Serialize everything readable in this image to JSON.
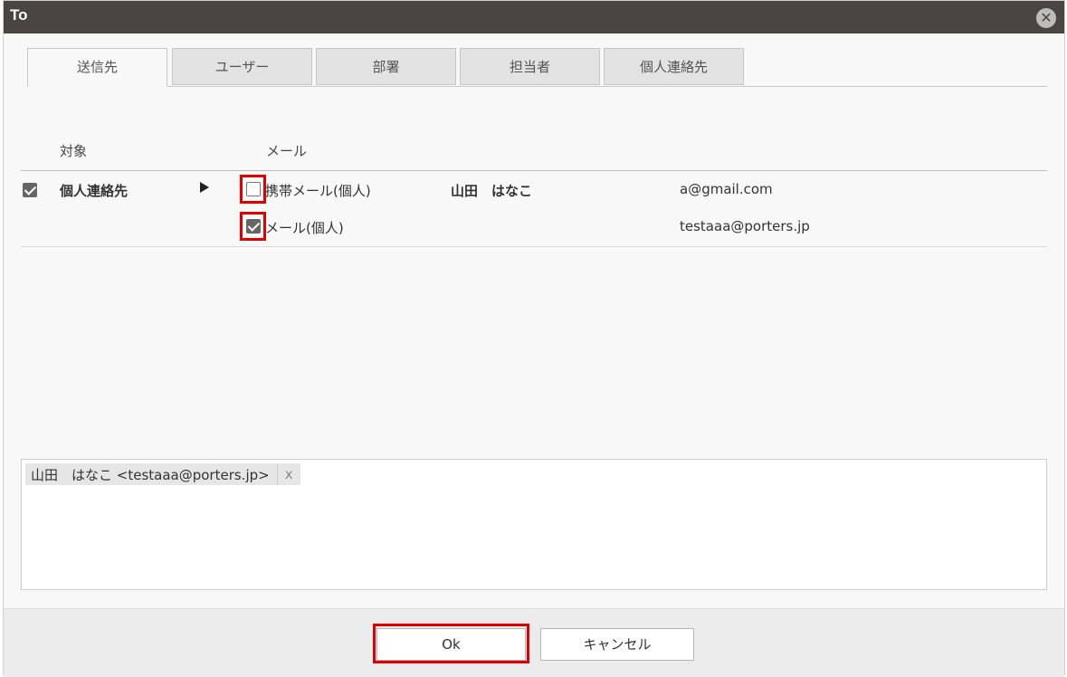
{
  "dialog": {
    "title": "To",
    "close_glyph": "✕"
  },
  "tabs": [
    {
      "label": "送信先",
      "active": true
    },
    {
      "label": "ユーザー",
      "active": false
    },
    {
      "label": "部署",
      "active": false
    },
    {
      "label": "担当者",
      "active": false
    },
    {
      "label": "個人連絡先",
      "active": false
    }
  ],
  "table": {
    "headers": {
      "target": "対象",
      "mail": "メール"
    },
    "row": {
      "checked": true,
      "target": "個人連絡先",
      "name": "山田　はなこ",
      "mails": [
        {
          "type": "携帯メール(個人)",
          "address": "a@gmail.com",
          "checked": false
        },
        {
          "type": "メール(個人)",
          "address": "testaaa@porters.jp",
          "checked": true
        }
      ]
    }
  },
  "selected": {
    "chips": [
      {
        "label": "山田　はなこ <testaaa@porters.jp>",
        "remove": "x"
      }
    ]
  },
  "footer": {
    "ok_label": "Ok",
    "cancel_label": "キャンセル"
  },
  "colors": {
    "titlebar": "#4a4442",
    "highlight": "#e00000"
  }
}
